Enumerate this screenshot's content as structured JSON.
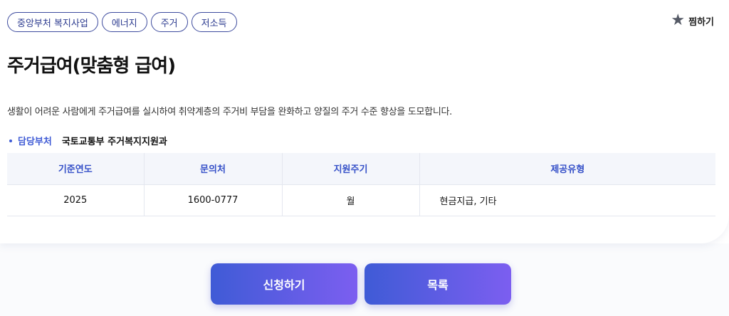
{
  "tags": [
    "중앙부처 복지사업",
    "에너지",
    "주거",
    "저소득"
  ],
  "favorite": {
    "icon": "star-icon",
    "label": "찜하기"
  },
  "title": "주거급여(맞춤형 급여)",
  "description": "생활이 어려운 사람에게 주거급여를 실시하여 취약계층의 주거비 부담을 완화하고 양질의 주거 수준 향상을 도모합니다.",
  "department": {
    "label": "담당부처",
    "value": "국토교통부 주거복지지원과"
  },
  "table": {
    "headers": [
      "기준연도",
      "문의처",
      "지원주기",
      "제공유형"
    ],
    "row": [
      "2025",
      "1600-0777",
      "월",
      "현금지급, 기타"
    ]
  },
  "buttons": {
    "apply": "신청하기",
    "list": "목록"
  },
  "colors": {
    "accent": "#3f5bd5",
    "gradient_end": "#7c5ef0"
  }
}
